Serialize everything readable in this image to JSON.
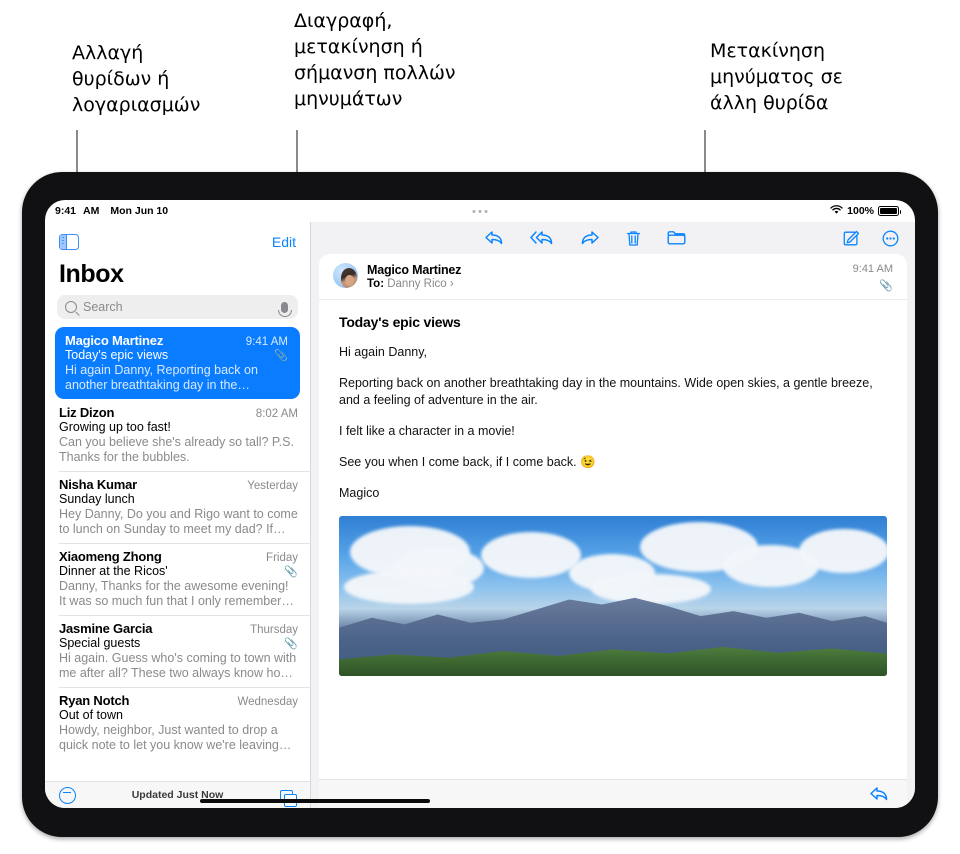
{
  "callouts": [
    {
      "id": "change-mailboxes",
      "text": "Αλλαγή\nθυρίδων ή\nλογαριασμών"
    },
    {
      "id": "multi-select",
      "text": "Διαγραφή,\nμετακίνηση ή\nσήμανση πολλών\nμηνυμάτων"
    },
    {
      "id": "move-message",
      "text": "Μετακίνηση\nμηνύματος σε\nάλλη θυρίδα"
    }
  ],
  "status_bar": {
    "time": "9:41",
    "am_pm": "AM",
    "date": "Mon Jun 10",
    "battery_percent": "100%",
    "wifi_icon": "wifi-icon",
    "battery_icon": "battery-icon"
  },
  "mail_list": {
    "sidebar_toggle_icon": "sidebar-toggle-icon",
    "edit_label": "Edit",
    "title": "Inbox",
    "search": {
      "placeholder": "Search",
      "search_icon": "search-icon",
      "mic_icon": "microphone-icon"
    },
    "items": [
      {
        "sender": "Magico Martinez",
        "time": "9:41 AM",
        "subject": "Today's epic views",
        "preview": "Hi again Danny, Reporting back on another breathtaking day in the mountains. Wide o…",
        "attachment": true,
        "selected": true
      },
      {
        "sender": "Liz Dizon",
        "time": "8:02 AM",
        "subject": "Growing up too fast!",
        "preview": "Can you believe she's already so tall? P.S. Thanks for the bubbles.",
        "attachment": false,
        "selected": false
      },
      {
        "sender": "Nisha Kumar",
        "time": "Yesterday",
        "subject": "Sunday lunch",
        "preview": "Hey Danny, Do you and Rigo want to come to lunch on Sunday to meet my dad? If you…",
        "attachment": false,
        "selected": false
      },
      {
        "sender": "Xiaomeng Zhong",
        "time": "Friday",
        "subject": "Dinner at the Ricos'",
        "preview": "Danny, Thanks for the awesome evening! It was so much fun that I only remembered t…",
        "attachment": true,
        "selected": false
      },
      {
        "sender": "Jasmine Garcia",
        "time": "Thursday",
        "subject": "Special guests",
        "preview": "Hi again. Guess who's coming to town with me after all? These two always know how t…",
        "attachment": true,
        "selected": false
      },
      {
        "sender": "Ryan Notch",
        "time": "Wednesday",
        "subject": "Out of town",
        "preview": "Howdy, neighbor, Just wanted to drop a quick note to let you know we're leaving T…",
        "attachment": false,
        "selected": false
      }
    ],
    "bottom_bar": {
      "filter_icon": "filter-icon",
      "status": "Updated Just Now",
      "cards_icon": "stacked-cards-icon"
    }
  },
  "reader": {
    "toolbar": {
      "reply_icon": "reply-icon",
      "reply_all_icon": "reply-all-icon",
      "forward_icon": "forward-icon",
      "delete_icon": "trash-icon",
      "move_icon": "folder-move-icon",
      "compose_icon": "compose-icon",
      "more_icon": "more-circle-icon"
    },
    "message": {
      "sender": "Magico Martinez",
      "to_label": "To:",
      "to_recipient": "Danny Rico",
      "disclosure": "›",
      "time": "9:41 AM",
      "attachment_icon": "paperclip-icon",
      "avatar_icon": "avatar",
      "subject": "Today's epic views",
      "paragraphs": [
        "Hi again Danny,",
        "Reporting back on another breathtaking day in the mountains. Wide open skies, a gentle breeze, and a feeling of adventure in the air.",
        "I felt like a character in a movie!",
        "See you when I come back, if I come back. 😉",
        "Magico"
      ],
      "photo_alt": "mountain-panorama-photo"
    },
    "bottom_reply_icon": "reply-icon"
  },
  "colors": {
    "accent_blue": "#0a84ff",
    "selected_blue": "#0a7cff",
    "bezel": "#111113",
    "reader_bg": "#f2f2f4"
  }
}
